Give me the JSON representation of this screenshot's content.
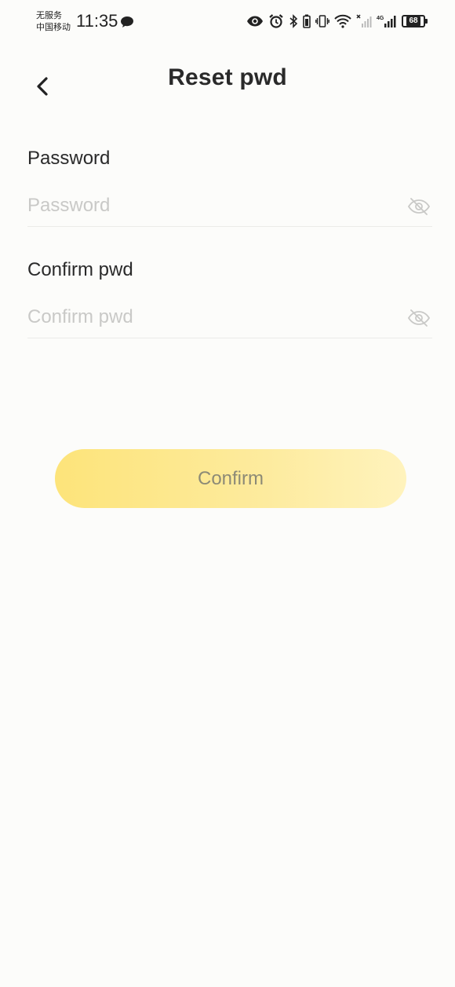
{
  "status_bar": {
    "carrier_line1": "无服务",
    "carrier_line2": "中国移动",
    "time": "11:35",
    "battery": "68"
  },
  "header": {
    "title": "Reset pwd"
  },
  "form": {
    "password": {
      "label": "Password",
      "placeholder": "Password",
      "value": ""
    },
    "confirm_password": {
      "label": "Confirm pwd",
      "placeholder": "Confirm pwd",
      "value": ""
    }
  },
  "actions": {
    "confirm_label": "Confirm"
  },
  "colors": {
    "background": "#fcfcfa",
    "button_gradient_start": "#fde47a",
    "button_gradient_end": "#fff3bd",
    "button_text": "#8c8a76",
    "placeholder": "#c9c9c7"
  },
  "icons": {
    "back": "chevron-left-icon",
    "password_toggle": "eye-off-icon",
    "confirm_toggle": "eye-off-icon"
  }
}
